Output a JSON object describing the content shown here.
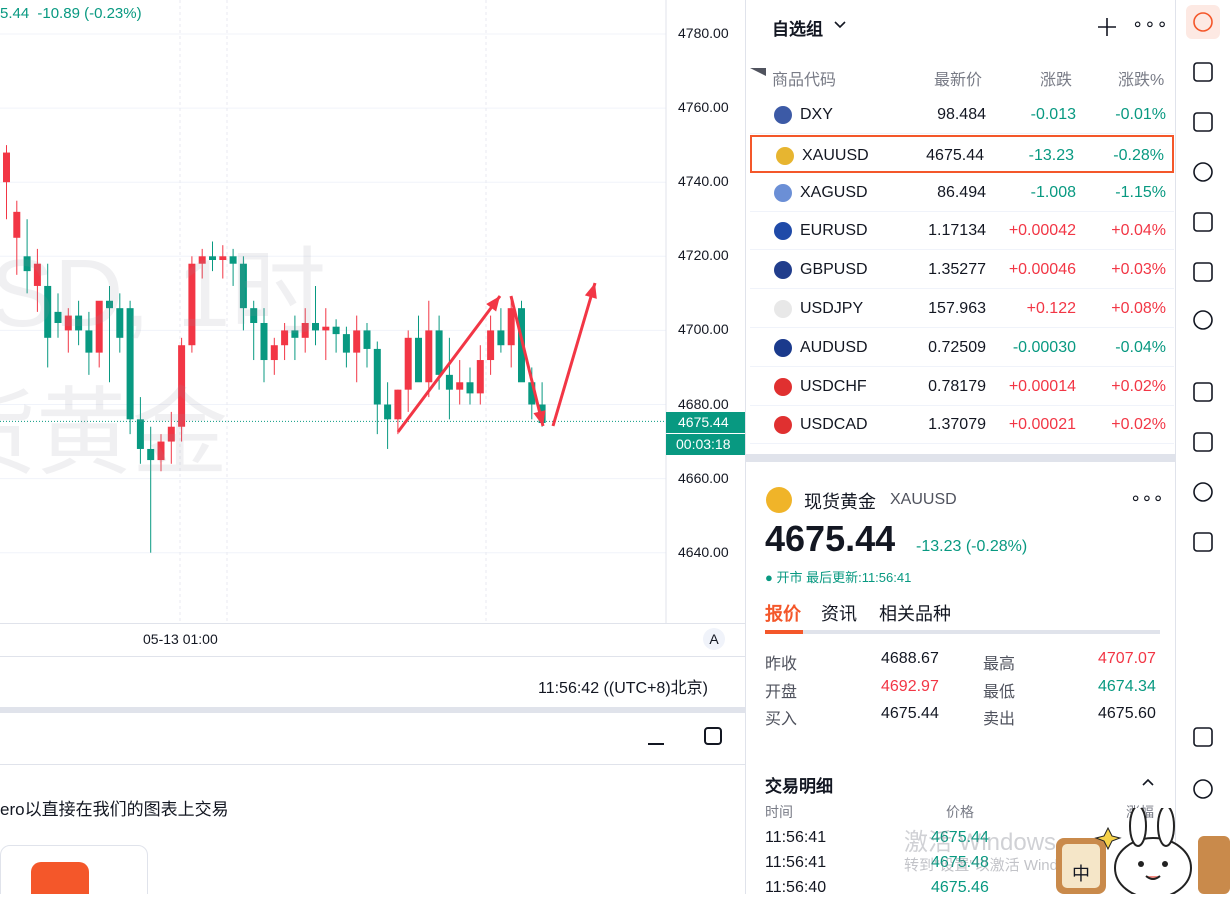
{
  "chart": {
    "header_price": "5.44",
    "header_change": "-10.89 (-0.23%)",
    "watermark_line1": "SD, 1时",
    "watermark_line2": "货黄金",
    "price_ticks": [
      "4780.00",
      "4760.00",
      "4740.00",
      "4720.00",
      "4700.00",
      "4680.00",
      "4660.00",
      "4640.00"
    ],
    "current_price_label": "4675.44",
    "countdown_label": "00:03:18",
    "x_tick": "05-13 01:00",
    "auto_scale": "A",
    "clock": "11:56:42 ((UTC+8)北京)",
    "bottom_text": "ero以直接在我们的图表上交易",
    "minimize_icon": "minimize-icon",
    "maximize_icon": "maximize-icon",
    "colors": {
      "up": "#f23645",
      "down": "#089981",
      "annotation": "#f23645"
    }
  },
  "chart_data": {
    "type": "candlestick",
    "ylim": [
      4630,
      4790
    ],
    "candles": [
      {
        "o": 4740,
        "h": 4750,
        "l": 4730,
        "c": 4748
      },
      {
        "o": 4725,
        "h": 4735,
        "l": 4715,
        "c": 4732
      },
      {
        "o": 4720,
        "h": 4730,
        "l": 4710,
        "c": 4716
      },
      {
        "o": 4712,
        "h": 4722,
        "l": 4705,
        "c": 4718
      },
      {
        "o": 4712,
        "h": 4718,
        "l": 4690,
        "c": 4698
      },
      {
        "o": 4705,
        "h": 4710,
        "l": 4698,
        "c": 4702
      },
      {
        "o": 4700,
        "h": 4706,
        "l": 4694,
        "c": 4704
      },
      {
        "o": 4704,
        "h": 4708,
        "l": 4696,
        "c": 4700
      },
      {
        "o": 4700,
        "h": 4705,
        "l": 4688,
        "c": 4694
      },
      {
        "o": 4694,
        "h": 4702,
        "l": 4690,
        "c": 4708
      },
      {
        "o": 4708,
        "h": 4712,
        "l": 4686,
        "c": 4706
      },
      {
        "o": 4706,
        "h": 4710,
        "l": 4694,
        "c": 4698
      },
      {
        "o": 4706,
        "h": 4708,
        "l": 4672,
        "c": 4676
      },
      {
        "o": 4676,
        "h": 4682,
        "l": 4664,
        "c": 4668
      },
      {
        "o": 4668,
        "h": 4674,
        "l": 4640,
        "c": 4665
      },
      {
        "o": 4665,
        "h": 4672,
        "l": 4662,
        "c": 4670
      },
      {
        "o": 4670,
        "h": 4678,
        "l": 4664,
        "c": 4674
      },
      {
        "o": 4674,
        "h": 4698,
        "l": 4670,
        "c": 4696
      },
      {
        "o": 4696,
        "h": 4720,
        "l": 4694,
        "c": 4718
      },
      {
        "o": 4718,
        "h": 4722,
        "l": 4714,
        "c": 4720
      },
      {
        "o": 4720,
        "h": 4724,
        "l": 4716,
        "c": 4719
      },
      {
        "o": 4719,
        "h": 4723,
        "l": 4714,
        "c": 4720
      },
      {
        "o": 4720,
        "h": 4722,
        "l": 4712,
        "c": 4718
      },
      {
        "o": 4718,
        "h": 4720,
        "l": 4700,
        "c": 4706
      },
      {
        "o": 4706,
        "h": 4708,
        "l": 4692,
        "c": 4702
      },
      {
        "o": 4702,
        "h": 4706,
        "l": 4686,
        "c": 4692
      },
      {
        "o": 4692,
        "h": 4698,
        "l": 4688,
        "c": 4696
      },
      {
        "o": 4696,
        "h": 4702,
        "l": 4692,
        "c": 4700
      },
      {
        "o": 4700,
        "h": 4704,
        "l": 4692,
        "c": 4698
      },
      {
        "o": 4698,
        "h": 4706,
        "l": 4694,
        "c": 4702
      },
      {
        "o": 4702,
        "h": 4712,
        "l": 4696,
        "c": 4700
      },
      {
        "o": 4700,
        "h": 4706,
        "l": 4692,
        "c": 4701
      },
      {
        "o": 4701,
        "h": 4703,
        "l": 4694,
        "c": 4699
      },
      {
        "o": 4699,
        "h": 4701,
        "l": 4690,
        "c": 4694
      },
      {
        "o": 4694,
        "h": 4704,
        "l": 4686,
        "c": 4700
      },
      {
        "o": 4700,
        "h": 4702,
        "l": 4690,
        "c": 4695
      },
      {
        "o": 4695,
        "h": 4697,
        "l": 4672,
        "c": 4680
      },
      {
        "o": 4680,
        "h": 4686,
        "l": 4668,
        "c": 4676
      },
      {
        "o": 4676,
        "h": 4684,
        "l": 4672,
        "c": 4684
      },
      {
        "o": 4684,
        "h": 4700,
        "l": 4678,
        "c": 4698
      },
      {
        "o": 4698,
        "h": 4704,
        "l": 4690,
        "c": 4686
      },
      {
        "o": 4686,
        "h": 4708,
        "l": 4682,
        "c": 4700
      },
      {
        "o": 4700,
        "h": 4704,
        "l": 4684,
        "c": 4688
      },
      {
        "o": 4688,
        "h": 4698,
        "l": 4676,
        "c": 4684
      },
      {
        "o": 4684,
        "h": 4692,
        "l": 4680,
        "c": 4686
      },
      {
        "o": 4686,
        "h": 4690,
        "l": 4680,
        "c": 4683
      },
      {
        "o": 4683,
        "h": 4696,
        "l": 4680,
        "c": 4692
      },
      {
        "o": 4692,
        "h": 4704,
        "l": 4688,
        "c": 4700
      },
      {
        "o": 4700,
        "h": 4706,
        "l": 4694,
        "c": 4696
      },
      {
        "o": 4696,
        "h": 4708,
        "l": 4690,
        "c": 4706
      },
      {
        "o": 4706,
        "h": 4708,
        "l": 4690,
        "c": 4686
      },
      {
        "o": 4686,
        "h": 4690,
        "l": 4676,
        "c": 4680
      },
      {
        "o": 4680,
        "h": 4686,
        "l": 4674,
        "c": 4675
      }
    ]
  },
  "watchlist": {
    "title": "自选组",
    "columns": [
      "商品代码",
      "最新价",
      "涨跌",
      "涨跌%"
    ],
    "rows": [
      {
        "sym": "DXY",
        "last": "98.484",
        "chg": "-0.013",
        "pct": "-0.01%",
        "dir": "dn",
        "flag": "#3c5aa6"
      },
      {
        "sym": "XAUUSD",
        "last": "4675.44",
        "chg": "-13.23",
        "pct": "-0.28%",
        "dir": "dn",
        "flag": "#e7b530"
      },
      {
        "sym": "XAGUSD",
        "last": "86.494",
        "chg": "-1.008",
        "pct": "-1.15%",
        "dir": "dn",
        "flag": "#6b8fd6"
      },
      {
        "sym": "EURUSD",
        "last": "1.17134",
        "chg": "+0.00042",
        "pct": "+0.04%",
        "dir": "up",
        "flag": "#1f4aa8"
      },
      {
        "sym": "GBPUSD",
        "last": "1.35277",
        "chg": "+0.00046",
        "pct": "+0.03%",
        "dir": "up",
        "flag": "#213d8c"
      },
      {
        "sym": "USDJPY",
        "last": "157.963",
        "chg": "+0.122",
        "pct": "+0.08%",
        "dir": "up",
        "flag": "#e8e8e8"
      },
      {
        "sym": "AUDUSD",
        "last": "0.72509",
        "chg": "-0.00030",
        "pct": "-0.04%",
        "dir": "dn",
        "flag": "#1a3a8c"
      },
      {
        "sym": "USDCHF",
        "last": "0.78179",
        "chg": "+0.00014",
        "pct": "+0.02%",
        "dir": "up",
        "flag": "#e03030"
      },
      {
        "sym": "USDCAD",
        "last": "1.37079",
        "chg": "+0.00021",
        "pct": "+0.02%",
        "dir": "up",
        "flag": "#e03030"
      }
    ]
  },
  "detail": {
    "name": "现货黄金",
    "symbol": "XAUUSD",
    "price": "4675.44",
    "change": "-13.23 (-0.28%)",
    "status": "● 开市 最后更新:11:56:41",
    "tabs": [
      "报价",
      "资讯",
      "相关品种"
    ],
    "stats": [
      {
        "k": "昨收",
        "v": "4688.67",
        "c": "n"
      },
      {
        "k": "最高",
        "v": "4707.07",
        "c": "up"
      },
      {
        "k": "开盘",
        "v": "4692.97",
        "c": "up"
      },
      {
        "k": "最低",
        "v": "4674.34",
        "c": "dn"
      },
      {
        "k": "买入",
        "v": "4675.44",
        "c": "n"
      },
      {
        "k": "卖出",
        "v": "4675.60",
        "c": "n"
      }
    ],
    "trades_title": "交易明细",
    "trades_cols": [
      "时间",
      "价格",
      "涨幅"
    ],
    "trades": [
      {
        "t": "11:56:41",
        "p": "4675.44"
      },
      {
        "t": "11:56:41",
        "p": "4675.48"
      },
      {
        "t": "11:56:40",
        "p": "4675.46"
      }
    ]
  },
  "watermark_win": {
    "line1": "激活 Windows",
    "line2": "转到\"设置\"以激活 Windows。"
  },
  "right_bar_icons": [
    "watchlist-icon",
    "news-icon",
    "calendar-icon",
    "alert-icon",
    "layers-icon",
    "video-icon",
    "chat-icon",
    "target-icon",
    "education-icon",
    "table-icon",
    "network-icon",
    "handshake-icon",
    "support-icon"
  ]
}
